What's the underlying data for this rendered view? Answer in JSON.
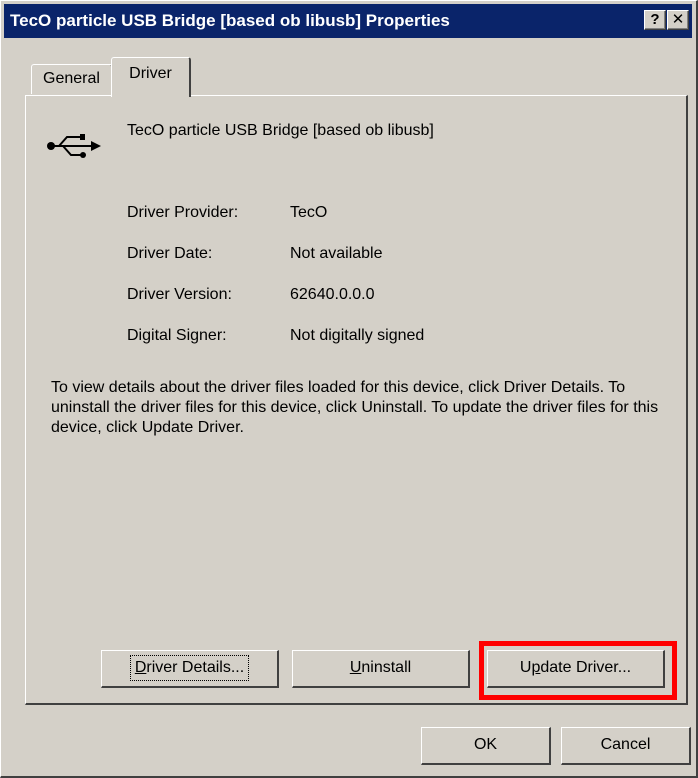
{
  "window": {
    "title": "TecO particle USB Bridge [based ob libusb] Properties",
    "help_label": "?",
    "close_label": "✕"
  },
  "tabs": [
    {
      "label": "General",
      "active": false
    },
    {
      "label": "Driver",
      "active": true
    }
  ],
  "device": {
    "icon": "usb-icon",
    "name": "TecO particle USB Bridge [based ob libusb]"
  },
  "driver_info": [
    {
      "label": "Driver Provider:",
      "value": "TecO"
    },
    {
      "label": "Driver Date:",
      "value": "Not available"
    },
    {
      "label": "Driver Version:",
      "value": "62640.0.0.0"
    },
    {
      "label": "Digital Signer:",
      "value": "Not digitally signed"
    }
  ],
  "description": "To view details about the driver files loaded for this device, click Driver Details. To uninstall the driver files for this device, click Uninstall. To update the driver files for this device, click Update Driver.",
  "buttons": {
    "driver_details": {
      "mnemonic": "D",
      "rest": "river Details..."
    },
    "uninstall": {
      "mnemonic": "U",
      "rest": "ninstall"
    },
    "update_driver": {
      "pre": "U",
      "mnemonic": "p",
      "rest": "date Driver..."
    },
    "ok": "OK",
    "cancel": "Cancel"
  },
  "colors": {
    "titlebar": "#0a246a",
    "highlight": "#ff0000",
    "face": "#d4d0c8"
  }
}
